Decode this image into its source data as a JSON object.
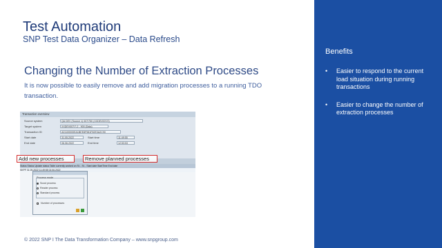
{
  "slide": {
    "title": "Test Automation",
    "subtitle": "SNP Test Data Organizer – Data Refresh",
    "heading": "Changing the Number of Extraction Processes",
    "body": "It is now possible to easily remove and add migration processes to a running TDO transaction.",
    "footer": "© 2022 SNP I The Data Transformation Company – www.snpgroup.com"
  },
  "sidebar": {
    "title": "Benefits",
    "bullets": [
      "Easier to respond to the current load situation during running transactions",
      "Easier to change the number of extraction processes"
    ]
  },
  "screenshot": {
    "overview_title": "Transaction overview",
    "fields": {
      "source_system_label": "Source system",
      "source_system_value": "QA DEV (Source 1) 007/750 (XXDEV007/2)",
      "target_system_label": "Target system",
      "target_system_value": "XXDEV007/7-2 - 900 (Data)",
      "transaction_id_label": "Transaction ID",
      "transaction_id_value": "A01100000EA1BEE8F981F82E3A2C90",
      "start_date_label": "Start date",
      "start_date_value": "31.05.2022",
      "start_time_label": "Start time",
      "start_time_value": "11:49:55",
      "end_date_label": "End date",
      "end_date_value": "06.06.2022",
      "end_time_label": "End time",
      "end_time_value": "12:53:53"
    },
    "grid_header": "Status  Status  Update status  Table currently worked on  St...  St...  Start date  StartTime  End date",
    "grid_row": "SKPF                                   31.05.2022  11:49:55  02.06.2022",
    "popup": {
      "group_title": "Process mode",
      "options": [
        "Scout process",
        "Reader process",
        "Standard process"
      ],
      "selected_index": 0,
      "number_label": "Number of processes"
    },
    "callout_add": "Add new processes",
    "callout_remove": "Remove planned processes"
  }
}
